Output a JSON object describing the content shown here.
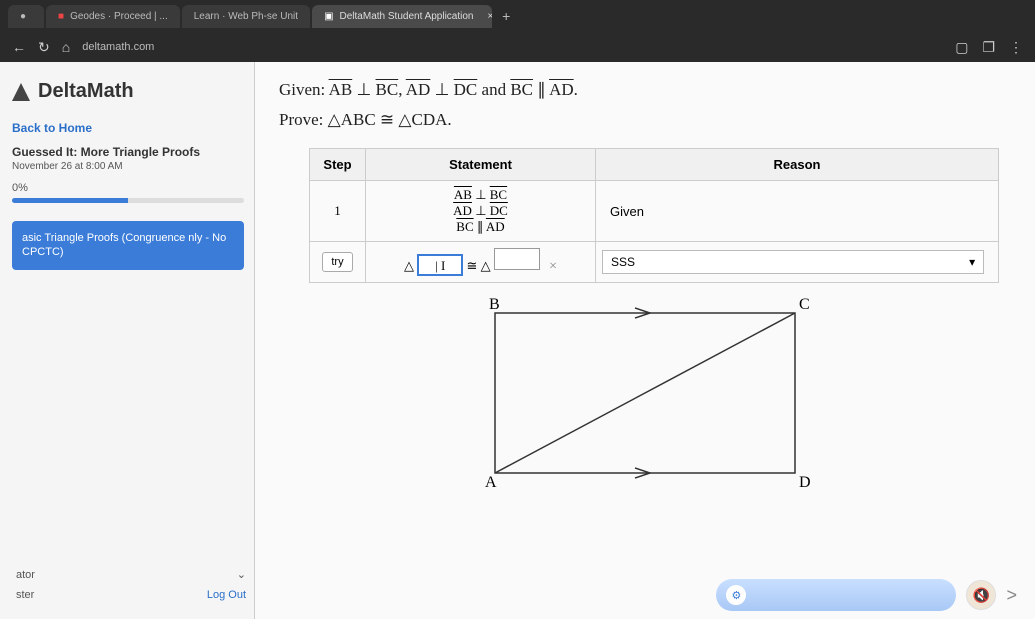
{
  "browser": {
    "tabs": [
      {
        "label": ""
      },
      {
        "label": "Geodes · Proceed | ..."
      },
      {
        "label": "Learn · Web Ph-se Unit"
      },
      {
        "label": "DeltaMath Student Application"
      }
    ],
    "nav": {
      "back": "←",
      "refresh": "↻",
      "home": "⌂"
    },
    "url": "deltamath.com",
    "right_icons": {
      "window": "▢",
      "copy": "❐",
      "menu": "⋮"
    }
  },
  "sidebar": {
    "brand": "DeltaMath",
    "back": "Back to Home",
    "assignment": "Guessed It: More Triangle Proofs",
    "due": "November 26 at 8:00 AM",
    "score": "0%",
    "progress_seg_a": "",
    "skill_card": "asic Triangle Proofs (Congruence nly - No CPCTC)",
    "ator": "ator",
    "ster": "ster",
    "logout": "Log Out",
    "chevron": "⌄"
  },
  "problem": {
    "given_label": "Given: ",
    "given_1a": "AB",
    "given_perp1": " ⊥ ",
    "given_1b": "BC",
    "given_sep1": ", ",
    "given_2a": "AD",
    "given_perp2": " ⊥ ",
    "given_2b": "DC",
    "given_and": " and ",
    "given_3a": "BC",
    "given_par": " ∥ ",
    "given_3b": "AD",
    "given_end": ".",
    "prove_label": "Prove: ",
    "prove_t1": "△ABC",
    "prove_cong": " ≅ ",
    "prove_t2": "△CDA",
    "prove_end": "."
  },
  "table": {
    "h_step": "Step",
    "h_stmt": "Statement",
    "h_reason": "Reason",
    "r1_step": "1",
    "r1_s1a": "AB",
    "r1_s1p": " ⊥ ",
    "r1_s1b": "BC",
    "r1_s2a": "AD",
    "r1_s2p": " ⊥ ",
    "r1_s2b": "DC",
    "r1_s3a": "BC",
    "r1_s3p": " ∥ ",
    "r1_s3b": "AD",
    "r1_reason": "Given",
    "r2_try": "try",
    "r2_tri1": "△",
    "r2_input_val": "| I",
    "r2_cong": " ≅ ",
    "r2_tri2": "△",
    "r2_x": "×",
    "r2_reason": "SSS",
    "r2_caret": "▾"
  },
  "figure": {
    "B": "B",
    "C": "C",
    "A": "A",
    "D": "D"
  },
  "shelf": {
    "gear": "⚙",
    "mute": "🔇",
    "next": ">"
  }
}
